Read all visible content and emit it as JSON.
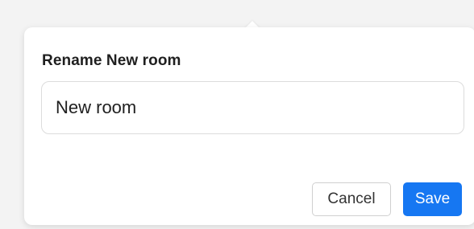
{
  "dialog": {
    "title": "Rename New room",
    "input_value": "New room",
    "cancel_label": "Cancel",
    "save_label": "Save"
  },
  "colors": {
    "accent": "#1677f2",
    "background": "#f3f3f3",
    "panel": "#ffffff"
  }
}
